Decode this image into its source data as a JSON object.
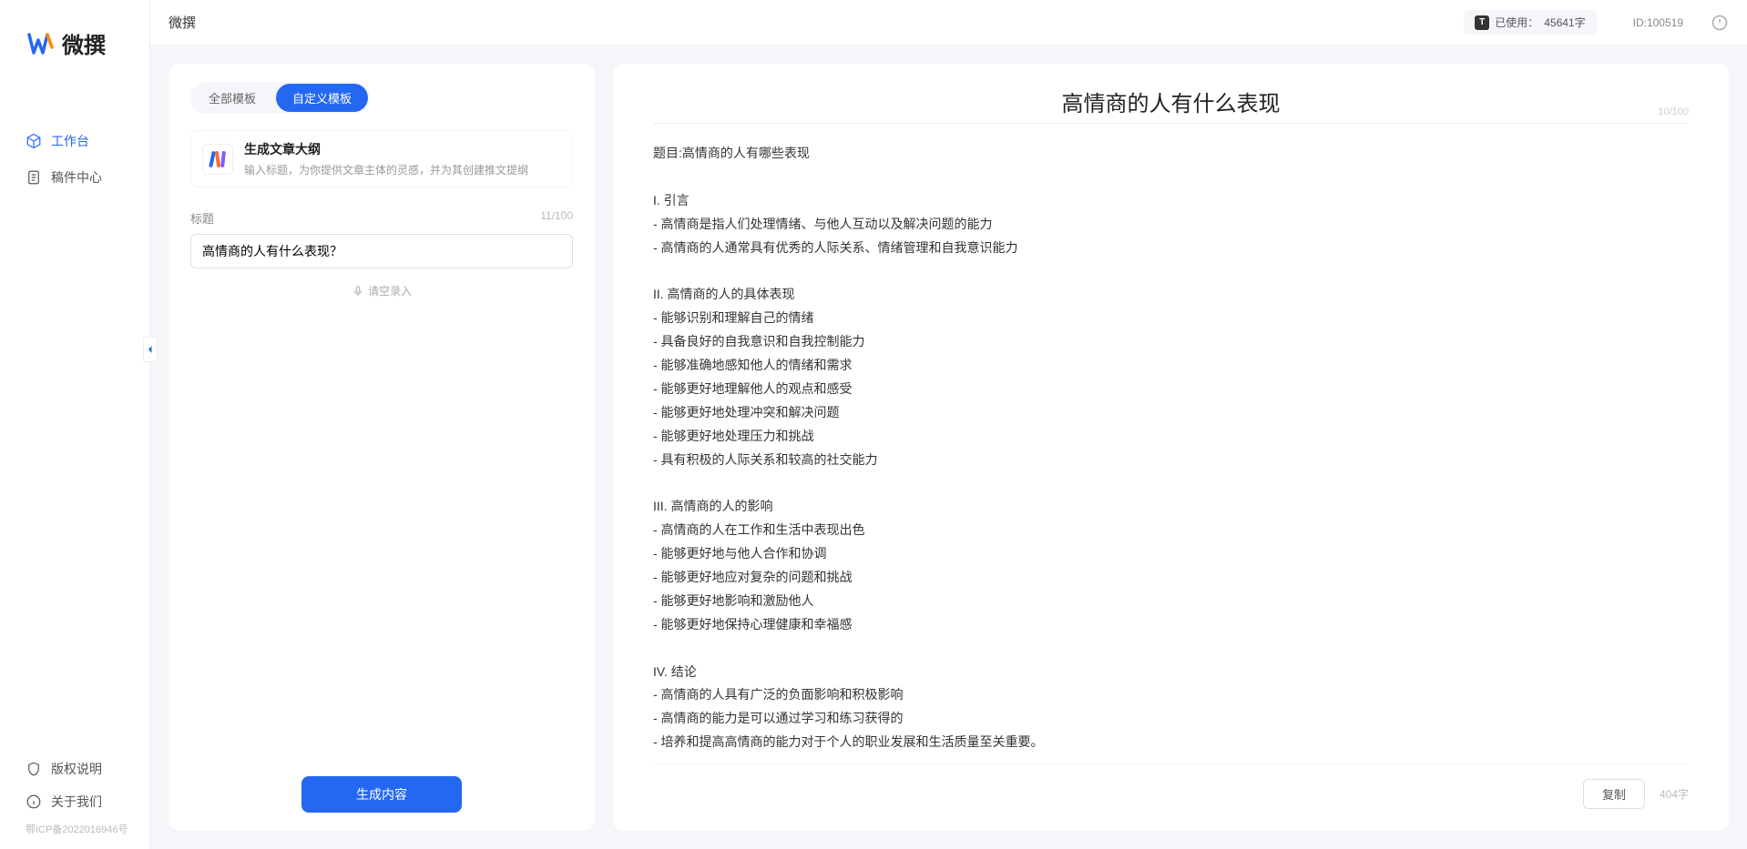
{
  "app": {
    "name": "微撰",
    "topbar_title": "微撰",
    "usage_label": "已使用：",
    "usage_value": "45641字",
    "user_id_label": "ID:",
    "user_id": "100519"
  },
  "sidebar": {
    "nav": [
      {
        "label": "工作台",
        "icon": "cube-icon",
        "active": true
      },
      {
        "label": "稿件中心",
        "icon": "document-icon",
        "active": false
      }
    ],
    "footer": [
      {
        "label": "版权说明",
        "icon": "shield-icon"
      },
      {
        "label": "关于我们",
        "icon": "info-icon"
      }
    ],
    "icp": "鄂ICP备2022016946号"
  },
  "left_panel": {
    "tabs": [
      {
        "label": "全部模板",
        "active": false
      },
      {
        "label": "自定义模板",
        "active": true
      }
    ],
    "template": {
      "title": "生成文章大纲",
      "desc": "输入标题，为你提供文章主体的灵感，并为其创建推文提纲"
    },
    "title_field": {
      "label": "标题",
      "counter": "11/100",
      "value": "高情商的人有什么表现？"
    },
    "voice_hint": "请空录入",
    "generate_label": "生成内容"
  },
  "right_panel": {
    "title": "高情商的人有什么表现",
    "title_counter": "10/100",
    "body": "题目:高情商的人有哪些表现\n\nI. 引言\n- 高情商是指人们处理情绪、与他人互动以及解决问题的能力\n- 高情商的人通常具有优秀的人际关系、情绪管理和自我意识能力\n\nII. 高情商的人的具体表现\n- 能够识别和理解自己的情绪\n- 具备良好的自我意识和自我控制能力\n- 能够准确地感知他人的情绪和需求\n- 能够更好地理解他人的观点和感受\n- 能够更好地处理冲突和解决问题\n- 能够更好地处理压力和挑战\n- 具有积极的人际关系和较高的社交能力\n\nIII. 高情商的人的影响\n- 高情商的人在工作和生活中表现出色\n- 能够更好地与他人合作和协调\n- 能够更好地应对复杂的问题和挑战\n- 能够更好地影响和激励他人\n- 能够更好地保持心理健康和幸福感\n\nIV. 结论\n- 高情商的人具有广泛的负面影响和积极影响\n- 高情商的能力是可以通过学习和练习获得的\n- 培养和提高高情商的能力对于个人的职业发展和生活质量至关重要。",
    "copy_label": "复制",
    "word_count": "404字"
  }
}
